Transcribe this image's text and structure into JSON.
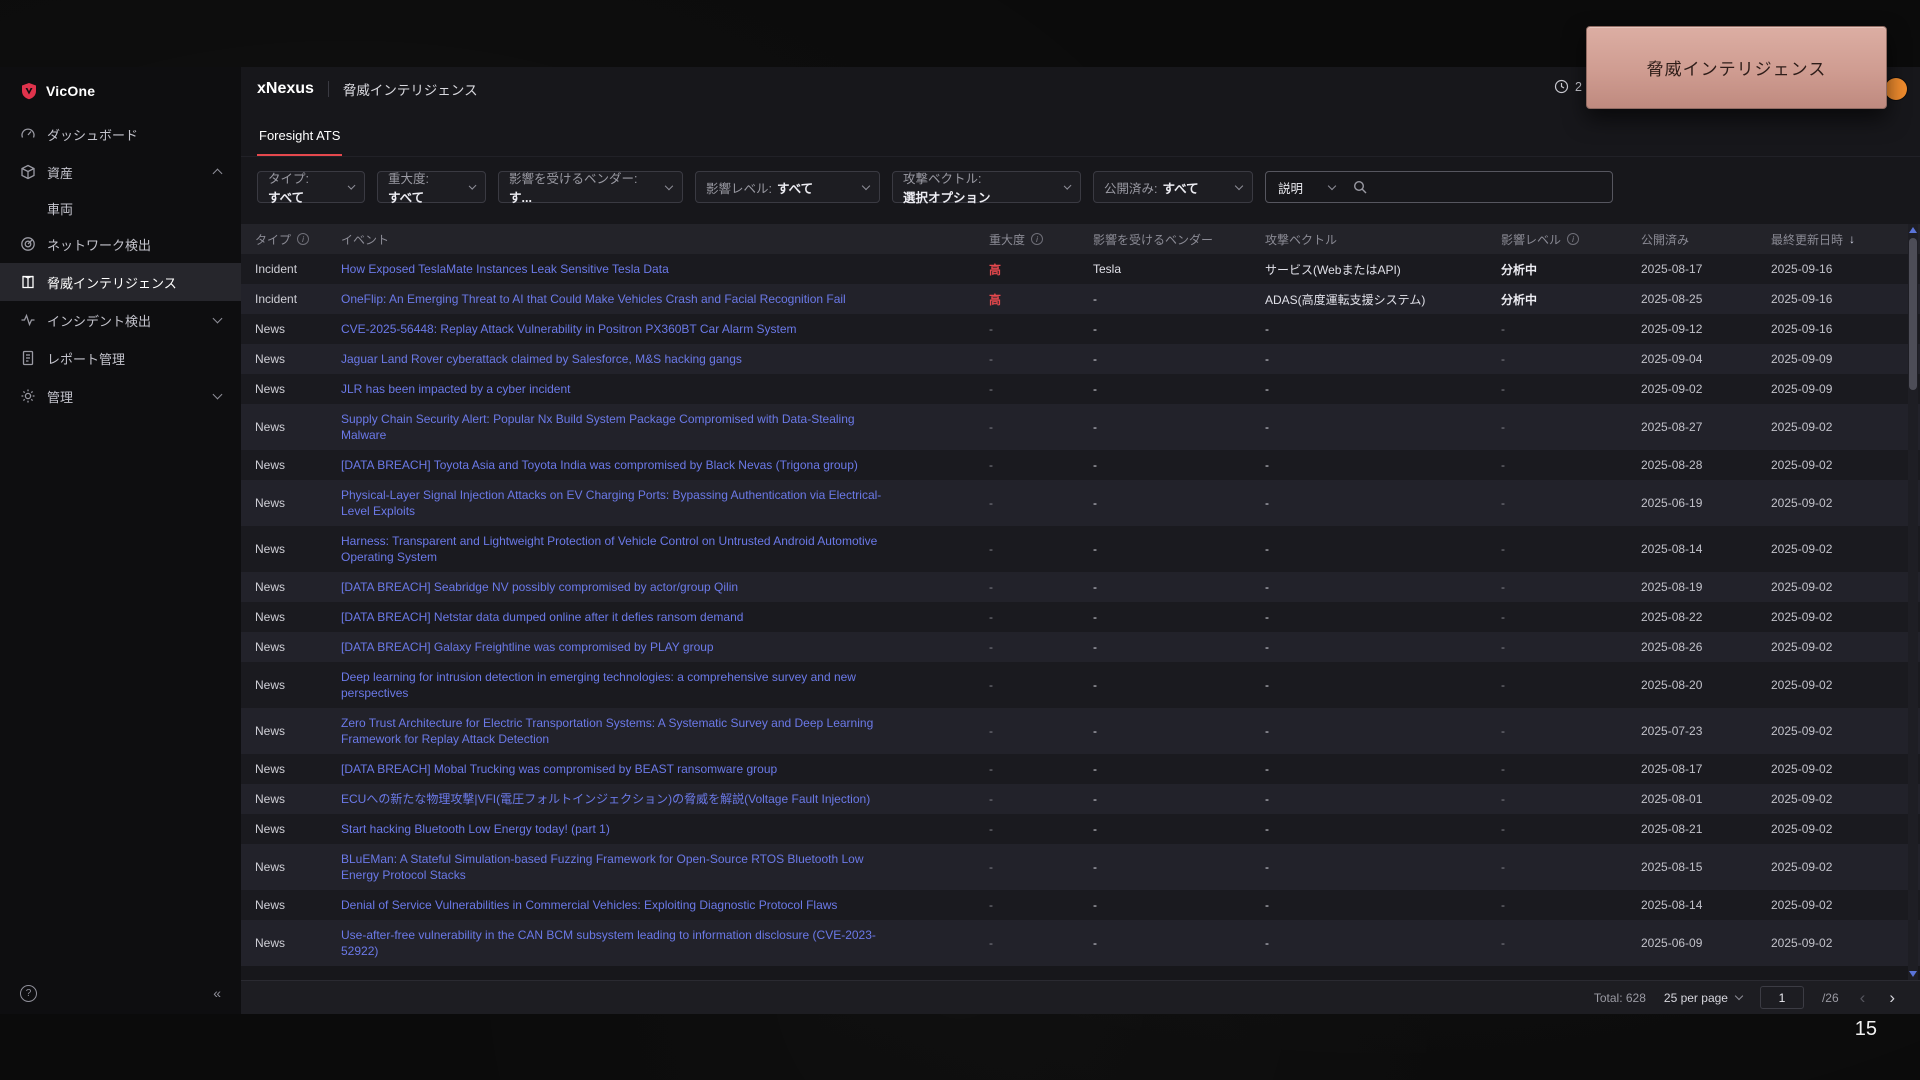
{
  "slide": {
    "page_number": "15",
    "callout_text": "脅威インテリジェンス"
  },
  "brand": {
    "name": "VicOne"
  },
  "sidebar": {
    "items": [
      {
        "label": "ダッシュボード"
      },
      {
        "label": "資産"
      },
      {
        "label": "車両"
      },
      {
        "label": "ネットワーク検出"
      },
      {
        "label": "脅威インテリジェンス"
      },
      {
        "label": "インシデント検出"
      },
      {
        "label": "レポート管理"
      },
      {
        "label": "管理"
      }
    ],
    "footer": {
      "help": "?",
      "collapse": "«"
    }
  },
  "header": {
    "app_name": "xNexus",
    "page_title": "脅威インテリジェンス",
    "clock_value": "2"
  },
  "tabs": [
    {
      "label": "Foresight ATS"
    }
  ],
  "filters": [
    {
      "label": "タイプ:",
      "value": "すべて"
    },
    {
      "label": "重大度:",
      "value": "すべて"
    },
    {
      "label": "影響を受けるベンダー:",
      "value": "す..."
    },
    {
      "label": "影響レベル:",
      "value": "すべて"
    },
    {
      "label": "攻撃ベクトル:",
      "value": "選択オプション"
    },
    {
      "label": "公開済み:",
      "value": "すべて"
    }
  ],
  "search": {
    "field": "説明",
    "query": ""
  },
  "table": {
    "columns": [
      {
        "label": "タイプ"
      },
      {
        "label": "イベント"
      },
      {
        "label": "重大度"
      },
      {
        "label": "影響を受けるベンダー"
      },
      {
        "label": "攻撃ベクトル"
      },
      {
        "label": "影響レベル"
      },
      {
        "label": "公開済み"
      },
      {
        "label": "最終更新日時"
      }
    ],
    "sort_icon": "↓",
    "rows": [
      {
        "type": "Incident",
        "event": "How Exposed TeslaMate Instances Leak Sensitive Tesla Data",
        "severity": "高",
        "vendor": "Tesla",
        "vector": "サービス(WebまたはAPI)",
        "level": "分析中",
        "published": "2025-08-17",
        "updated": "2025-09-16"
      },
      {
        "type": "Incident",
        "event": "OneFlip: An Emerging Threat to AI that Could Make Vehicles Crash and Facial Recognition Fail",
        "severity": "高",
        "vendor": "-",
        "vector": "ADAS(高度運転支援システム)",
        "level": "分析中",
        "published": "2025-08-25",
        "updated": "2025-09-16"
      },
      {
        "type": "News",
        "event": "CVE-2025-56448: Replay Attack Vulnerability in Positron PX360BT Car Alarm System",
        "severity": "-",
        "vendor": "-",
        "vector": "-",
        "level": "-",
        "published": "2025-09-12",
        "updated": "2025-09-16"
      },
      {
        "type": "News",
        "event": "Jaguar Land Rover cyberattack claimed by Salesforce, M&S hacking gangs",
        "severity": "-",
        "vendor": "-",
        "vector": "-",
        "level": "-",
        "published": "2025-09-04",
        "updated": "2025-09-09"
      },
      {
        "type": "News",
        "event": "JLR has been impacted by a cyber incident",
        "severity": "-",
        "vendor": "-",
        "vector": "-",
        "level": "-",
        "published": "2025-09-02",
        "updated": "2025-09-09"
      },
      {
        "type": "News",
        "event": "Supply Chain Security Alert: Popular Nx Build System Package Compromised with Data-Stealing Malware",
        "severity": "-",
        "vendor": "-",
        "vector": "-",
        "level": "-",
        "published": "2025-08-27",
        "updated": "2025-09-02"
      },
      {
        "type": "News",
        "event": "[DATA BREACH] Toyota Asia and Toyota India was compromised by Black Nevas (Trigona group)",
        "severity": "-",
        "vendor": "-",
        "vector": "-",
        "level": "-",
        "published": "2025-08-28",
        "updated": "2025-09-02"
      },
      {
        "type": "News",
        "event": "Physical-Layer Signal Injection Attacks on EV Charging Ports: Bypassing Authentication via Electrical-Level Exploits",
        "severity": "-",
        "vendor": "-",
        "vector": "-",
        "level": "-",
        "published": "2025-06-19",
        "updated": "2025-09-02"
      },
      {
        "type": "News",
        "event": "Harness: Transparent and Lightweight Protection of Vehicle Control on Untrusted Android Automotive Operating System",
        "severity": "-",
        "vendor": "-",
        "vector": "-",
        "level": "-",
        "published": "2025-08-14",
        "updated": "2025-09-02"
      },
      {
        "type": "News",
        "event": "[DATA BREACH] Seabridge NV possibly compromised by actor/group Qilin",
        "severity": "-",
        "vendor": "-",
        "vector": "-",
        "level": "-",
        "published": "2025-08-19",
        "updated": "2025-09-02"
      },
      {
        "type": "News",
        "event": "[DATA BREACH] Netstar data dumped online after it defies ransom demand",
        "severity": "-",
        "vendor": "-",
        "vector": "-",
        "level": "-",
        "published": "2025-08-22",
        "updated": "2025-09-02"
      },
      {
        "type": "News",
        "event": "[DATA BREACH] Galaxy Freightline was compromised by PLAY group",
        "severity": "-",
        "vendor": "-",
        "vector": "-",
        "level": "-",
        "published": "2025-08-26",
        "updated": "2025-09-02"
      },
      {
        "type": "News",
        "event": "Deep learning for intrusion detection in emerging technologies: a comprehensive survey and new perspectives",
        "severity": "-",
        "vendor": "-",
        "vector": "-",
        "level": "-",
        "published": "2025-08-20",
        "updated": "2025-09-02"
      },
      {
        "type": "News",
        "event": "Zero Trust Architecture for Electric Transportation Systems: A Systematic Survey and Deep Learning Framework for Replay Attack Detection",
        "severity": "-",
        "vendor": "-",
        "vector": "-",
        "level": "-",
        "published": "2025-07-23",
        "updated": "2025-09-02"
      },
      {
        "type": "News",
        "event": "[DATA BREACH] Mobal Trucking was compromised by BEAST ransomware group",
        "severity": "-",
        "vendor": "-",
        "vector": "-",
        "level": "-",
        "published": "2025-08-17",
        "updated": "2025-09-02"
      },
      {
        "type": "News",
        "event": "ECUへの新たな物理攻撃|VFI(電圧フォルトインジェクション)の脅威を解説(Voltage Fault Injection)",
        "severity": "-",
        "vendor": "-",
        "vector": "-",
        "level": "-",
        "published": "2025-08-01",
        "updated": "2025-09-02"
      },
      {
        "type": "News",
        "event": "Start hacking Bluetooth Low Energy today! (part 1)",
        "severity": "-",
        "vendor": "-",
        "vector": "-",
        "level": "-",
        "published": "2025-08-21",
        "updated": "2025-09-02"
      },
      {
        "type": "News",
        "event": "BLuEMan: A Stateful Simulation-based Fuzzing Framework for Open-Source RTOS Bluetooth Low Energy Protocol Stacks",
        "severity": "-",
        "vendor": "-",
        "vector": "-",
        "level": "-",
        "published": "2025-08-15",
        "updated": "2025-09-02"
      },
      {
        "type": "News",
        "event": "Denial of Service Vulnerabilities in Commercial Vehicles: Exploiting Diagnostic Protocol Flaws",
        "severity": "-",
        "vendor": "-",
        "vector": "-",
        "level": "-",
        "published": "2025-08-14",
        "updated": "2025-09-02"
      },
      {
        "type": "News",
        "event": "Use-after-free vulnerability in the CAN BCM subsystem leading to information disclosure (CVE-2023-52922)",
        "severity": "-",
        "vendor": "-",
        "vector": "-",
        "level": "-",
        "published": "2025-06-09",
        "updated": "2025-09-02"
      }
    ]
  },
  "pagination": {
    "total": "Total: 628",
    "per_page": "25 per page",
    "page": "1",
    "pages": "/26",
    "prev": "‹",
    "next": "›"
  }
}
